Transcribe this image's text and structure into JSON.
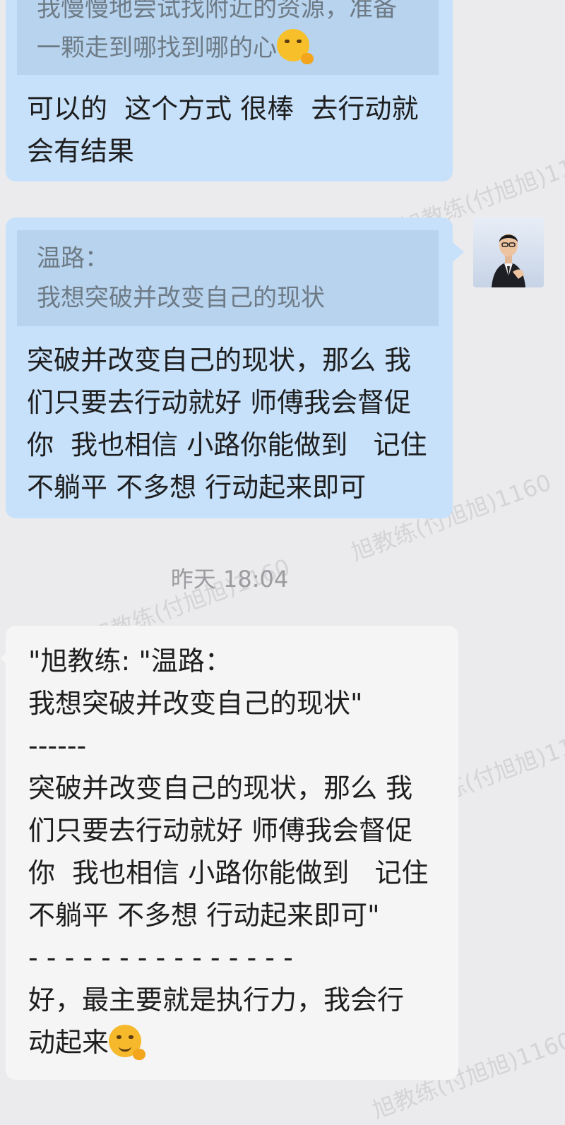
{
  "watermark": "旭教练(付旭旭)1160",
  "messages": {
    "m1": {
      "quote_lines": [
        "我慢慢地尝试找附近的资源，准备",
        "一颗走到哪找到哪的心"
      ],
      "text_lines": [
        "可以的  这个方式 很棒  去行动就",
        "会有结果"
      ]
    },
    "m2": {
      "quote_lines": [
        "温路：",
        "我想突破并改变自己的现状"
      ],
      "text_lines": [
        "突破并改变自己的现状，那么 我",
        "们只要去行动就好 师傅我会督促",
        "你  我也相信 小路你能做到   记住",
        "不躺平 不多想 行动起来即可"
      ]
    },
    "timestamp": "昨天  18:04",
    "m3": {
      "text_lines": [
        "\"旭教练: \"温路：",
        "我想突破并改变自己的现状\"",
        "------",
        "突破并改变自己的现状，那么 我",
        "们只要去行动就好 师傅我会督促",
        "你  我也相信 小路你能做到   记住",
        "不躺平 不多想 行动起来即可\"",
        "- - - - - - - - - - - - - - -",
        "好，最主要就是执行力，我会行",
        "动起来"
      ]
    }
  },
  "icons": {
    "emoji_thinking": "thinking-face-emoji",
    "emoji_determined": "determined-face-emoji",
    "avatar": "coach-avatar"
  },
  "colors": {
    "background": "#ebebed",
    "outgoing_bubble": "#c7e1fb",
    "quote_block": "#b7d3ee",
    "incoming_bubble": "#f5f5f5"
  }
}
